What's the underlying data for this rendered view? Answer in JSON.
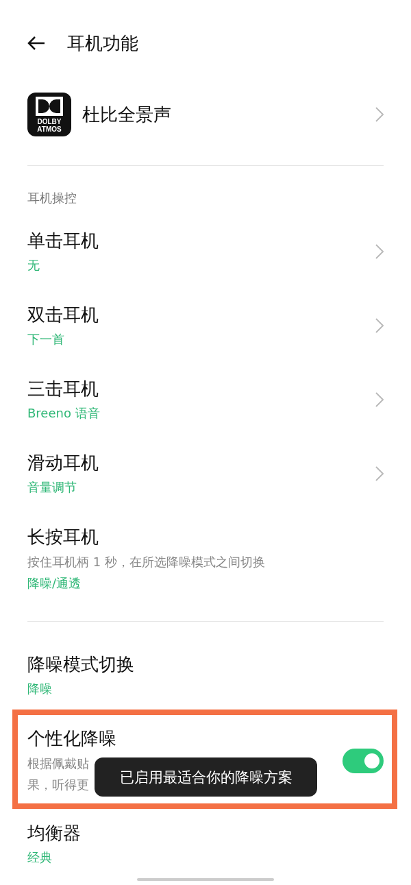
{
  "header": {
    "title": "耳机功能"
  },
  "dolby": {
    "logo_lines": [
      "DOLBY",
      "ATMOS"
    ],
    "label": "杜比全景声"
  },
  "control_section": {
    "title": "耳机操控",
    "items": [
      {
        "kind": "link",
        "title": "单击耳机",
        "value": "无"
      },
      {
        "kind": "link",
        "title": "双击耳机",
        "value": "下一首"
      },
      {
        "kind": "link",
        "title": "三击耳机",
        "value": "Breeno 语音"
      },
      {
        "kind": "link",
        "title": "滑动耳机",
        "value": "音量调节"
      },
      {
        "kind": "info",
        "title": "长按耳机",
        "description": "按住耳机柄 1 秒，在所选降噪模式之间切换",
        "value": "降噪/通透"
      }
    ]
  },
  "noise_mode": {
    "title": "降噪模式切换",
    "value": "降噪"
  },
  "personalized": {
    "title": "个性化降噪",
    "description_lines": [
      "根据佩戴贴",
      "果，听得更"
    ],
    "on": true
  },
  "equalizer": {
    "title": "均衡器",
    "value": "经典"
  },
  "toast": {
    "text": "已启用最适合你的降噪方案"
  }
}
